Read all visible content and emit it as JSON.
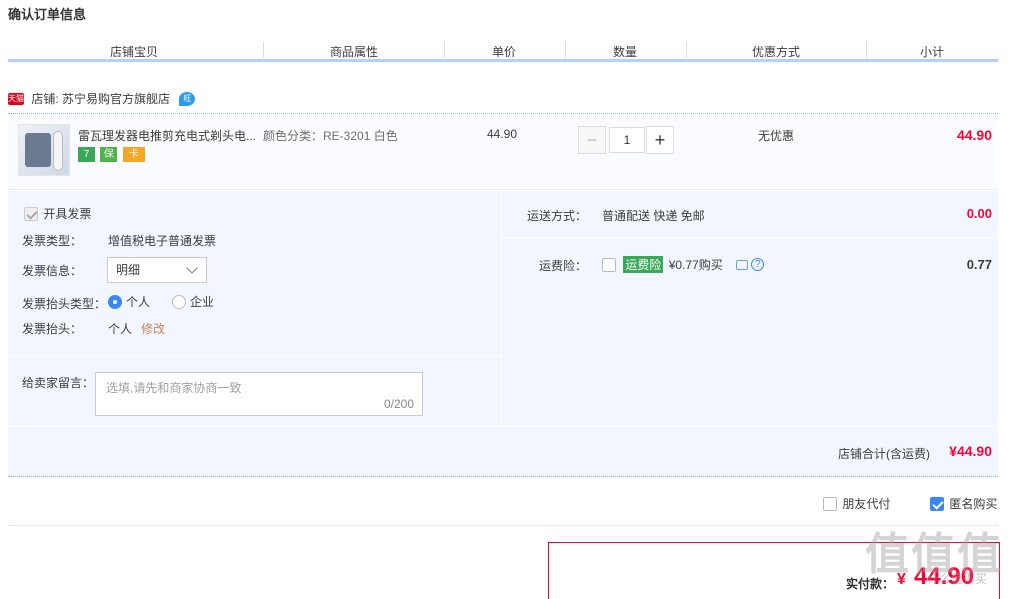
{
  "page": {
    "title": "确认订单信息"
  },
  "columns": [
    "店铺宝贝",
    "商品属性",
    "单价",
    "数量",
    "优惠方式",
    "小计"
  ],
  "shop": {
    "tmall_badge": "天猫",
    "label": "店铺: 苏宁易购官方旗舰店",
    "wangwang_badge": "旺"
  },
  "item": {
    "name": "雷瓦理发器电推剪充电式剃头电...",
    "badges": [
      {
        "text": "7",
        "color": "#3aa859"
      },
      {
        "text": "保",
        "color": "#4fb34a"
      },
      {
        "text": "卡",
        "color": "#f5a623"
      }
    ],
    "property": "颜色分类：RE-3201 白色",
    "price": "44.90",
    "quantity": "1",
    "minus": "−",
    "plus": "+",
    "promo": "无优惠",
    "subtotal": "44.90"
  },
  "invoice": {
    "open_label": "开具发票",
    "type_label": "发票类型：",
    "type_value": "增值税电子普通发票",
    "info_label": "发票信息：",
    "info_select": "明细",
    "header_type_label": "发票抬头类型：",
    "header_type_personal": "个人",
    "header_type_company": "企业",
    "header_label": "发票抬头：",
    "header_value": "个人",
    "modify": "修改"
  },
  "message": {
    "label": "给卖家留言：",
    "placeholder": "选填,请先和商家协商一致",
    "counter": "0/200"
  },
  "shipping": {
    "label": "运送方式：",
    "value": "普通配送 快递 免邮",
    "amount": "0.00"
  },
  "insurance": {
    "label": "运费险：",
    "tag": "运费险",
    "price_text": "¥0.77购买",
    "amount": "0.77"
  },
  "shop_total": {
    "label": "店铺合计(含运费)",
    "amount": "¥44.90"
  },
  "options": {
    "friend_pay": "朋友代付",
    "anonymous": "匿名购买"
  },
  "pay": {
    "label": "实付款：",
    "currency": "¥",
    "amount": "44.90"
  },
  "watermark": {
    "text": "值值值",
    "sub": "什么值得买"
  },
  "colors": {
    "accent": "#ff0036",
    "blue_line": "#b2d1ff",
    "panel_bg": "#f2f7ff",
    "check_blue": "#3b86f6"
  }
}
